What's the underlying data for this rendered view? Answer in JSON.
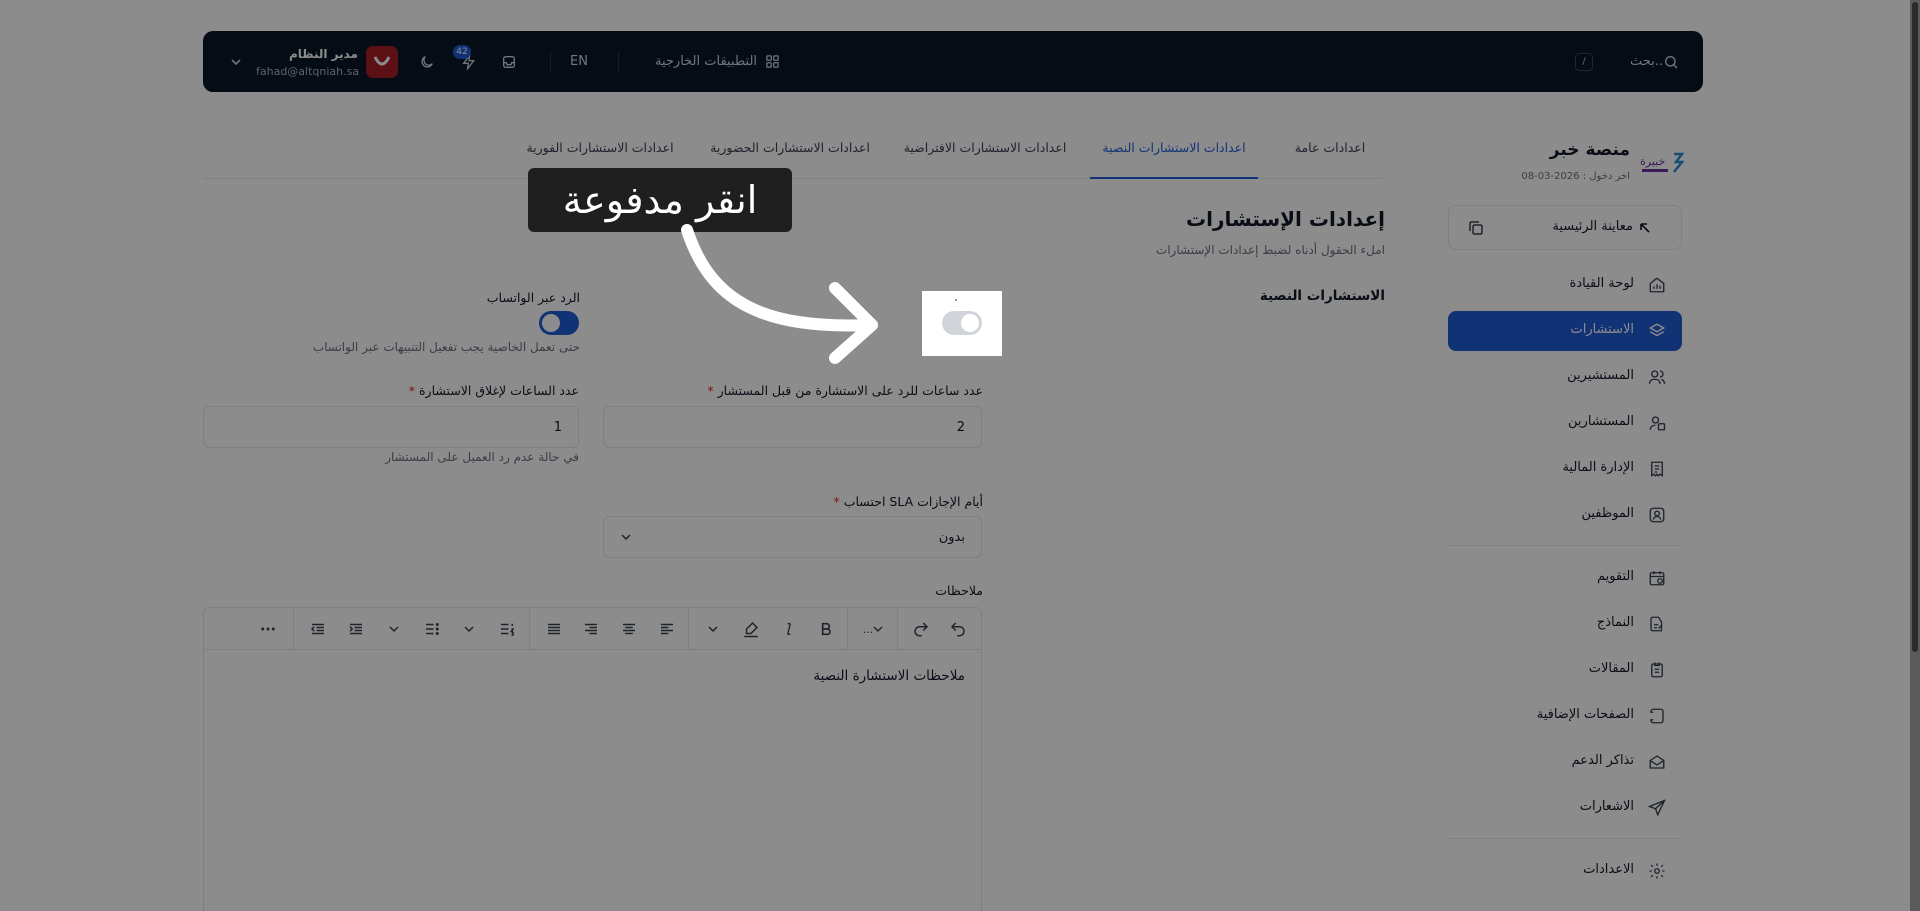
{
  "topbar": {
    "search_placeholder": "بحث..",
    "search_shortcut": "/",
    "external_apps": "التطبيقات الخارجية",
    "language": "EN",
    "notifications_count": "42",
    "user_name": "مدير النظام",
    "user_email": "fahad@altqniah.sa"
  },
  "brand": {
    "title": "منصة خبر",
    "last_login": "اخر دخول : 2026-03-08",
    "logo_text": "خبيرة"
  },
  "sidebar": {
    "home": "معاينة الرئيسية",
    "items": [
      {
        "label": "لوحة القيادة",
        "icon": "dashboard-icon"
      },
      {
        "label": "الاستشارات",
        "icon": "layers-icon"
      },
      {
        "label": "المستشيرين",
        "icon": "users-icon"
      },
      {
        "label": "المستشارين",
        "icon": "consultant-icon"
      },
      {
        "label": "الإدارة المالية",
        "icon": "finance-icon"
      },
      {
        "label": "الموظفين",
        "icon": "employee-icon"
      },
      {
        "label": "التقويم",
        "icon": "calendar-icon"
      },
      {
        "label": "النماذج",
        "icon": "forms-icon"
      },
      {
        "label": "المقالات",
        "icon": "articles-icon"
      },
      {
        "label": "الصفحات الإضافية",
        "icon": "pages-icon"
      },
      {
        "label": "تذاكر الدعم",
        "icon": "support-icon"
      },
      {
        "label": "الاشعارات",
        "icon": "send-icon"
      },
      {
        "label": "الاعدادات",
        "icon": "gear-icon"
      }
    ]
  },
  "tabs": [
    "اعدادات عامة",
    "اعدادات الاستشارات النصية",
    "اعدادات الاستشارات الافتراضية",
    "اعدادات الاستشارات الحضورية",
    "اعدادات الاستشارات الفورية"
  ],
  "form": {
    "title": "إعدادات الإستشارات",
    "subtitle": "املء الحقول أدناه لضبط إعدادات الإستشارات",
    "section": "الاستشارات النصية",
    "whatsapp_label": "الرد عبر الواتساب",
    "whatsapp_hint": "حتى تعمل الخاصية يجب تفعيل التنبيهات عبر الواتساب",
    "hours_reply_label": "عدد ساعات للرد على الاستشارة من قبل المستشار",
    "hours_reply_value": "2",
    "hours_close_label": "عدد الساعات لإغلاق الاستشارة",
    "hours_close_value": "1",
    "hours_close_hint": "في حالة عدم رد العميل على المستشار",
    "sla_label": "احتساب SLA أيام الإجازات",
    "sla_value": "بدون",
    "required_mark": "*",
    "notes_label": "ملاحظات",
    "notes_text": "ملاحظات الاستشارة النصية",
    "toolbar_heading": "..."
  },
  "overlay": {
    "callout": "انقر مدفوعة"
  }
}
